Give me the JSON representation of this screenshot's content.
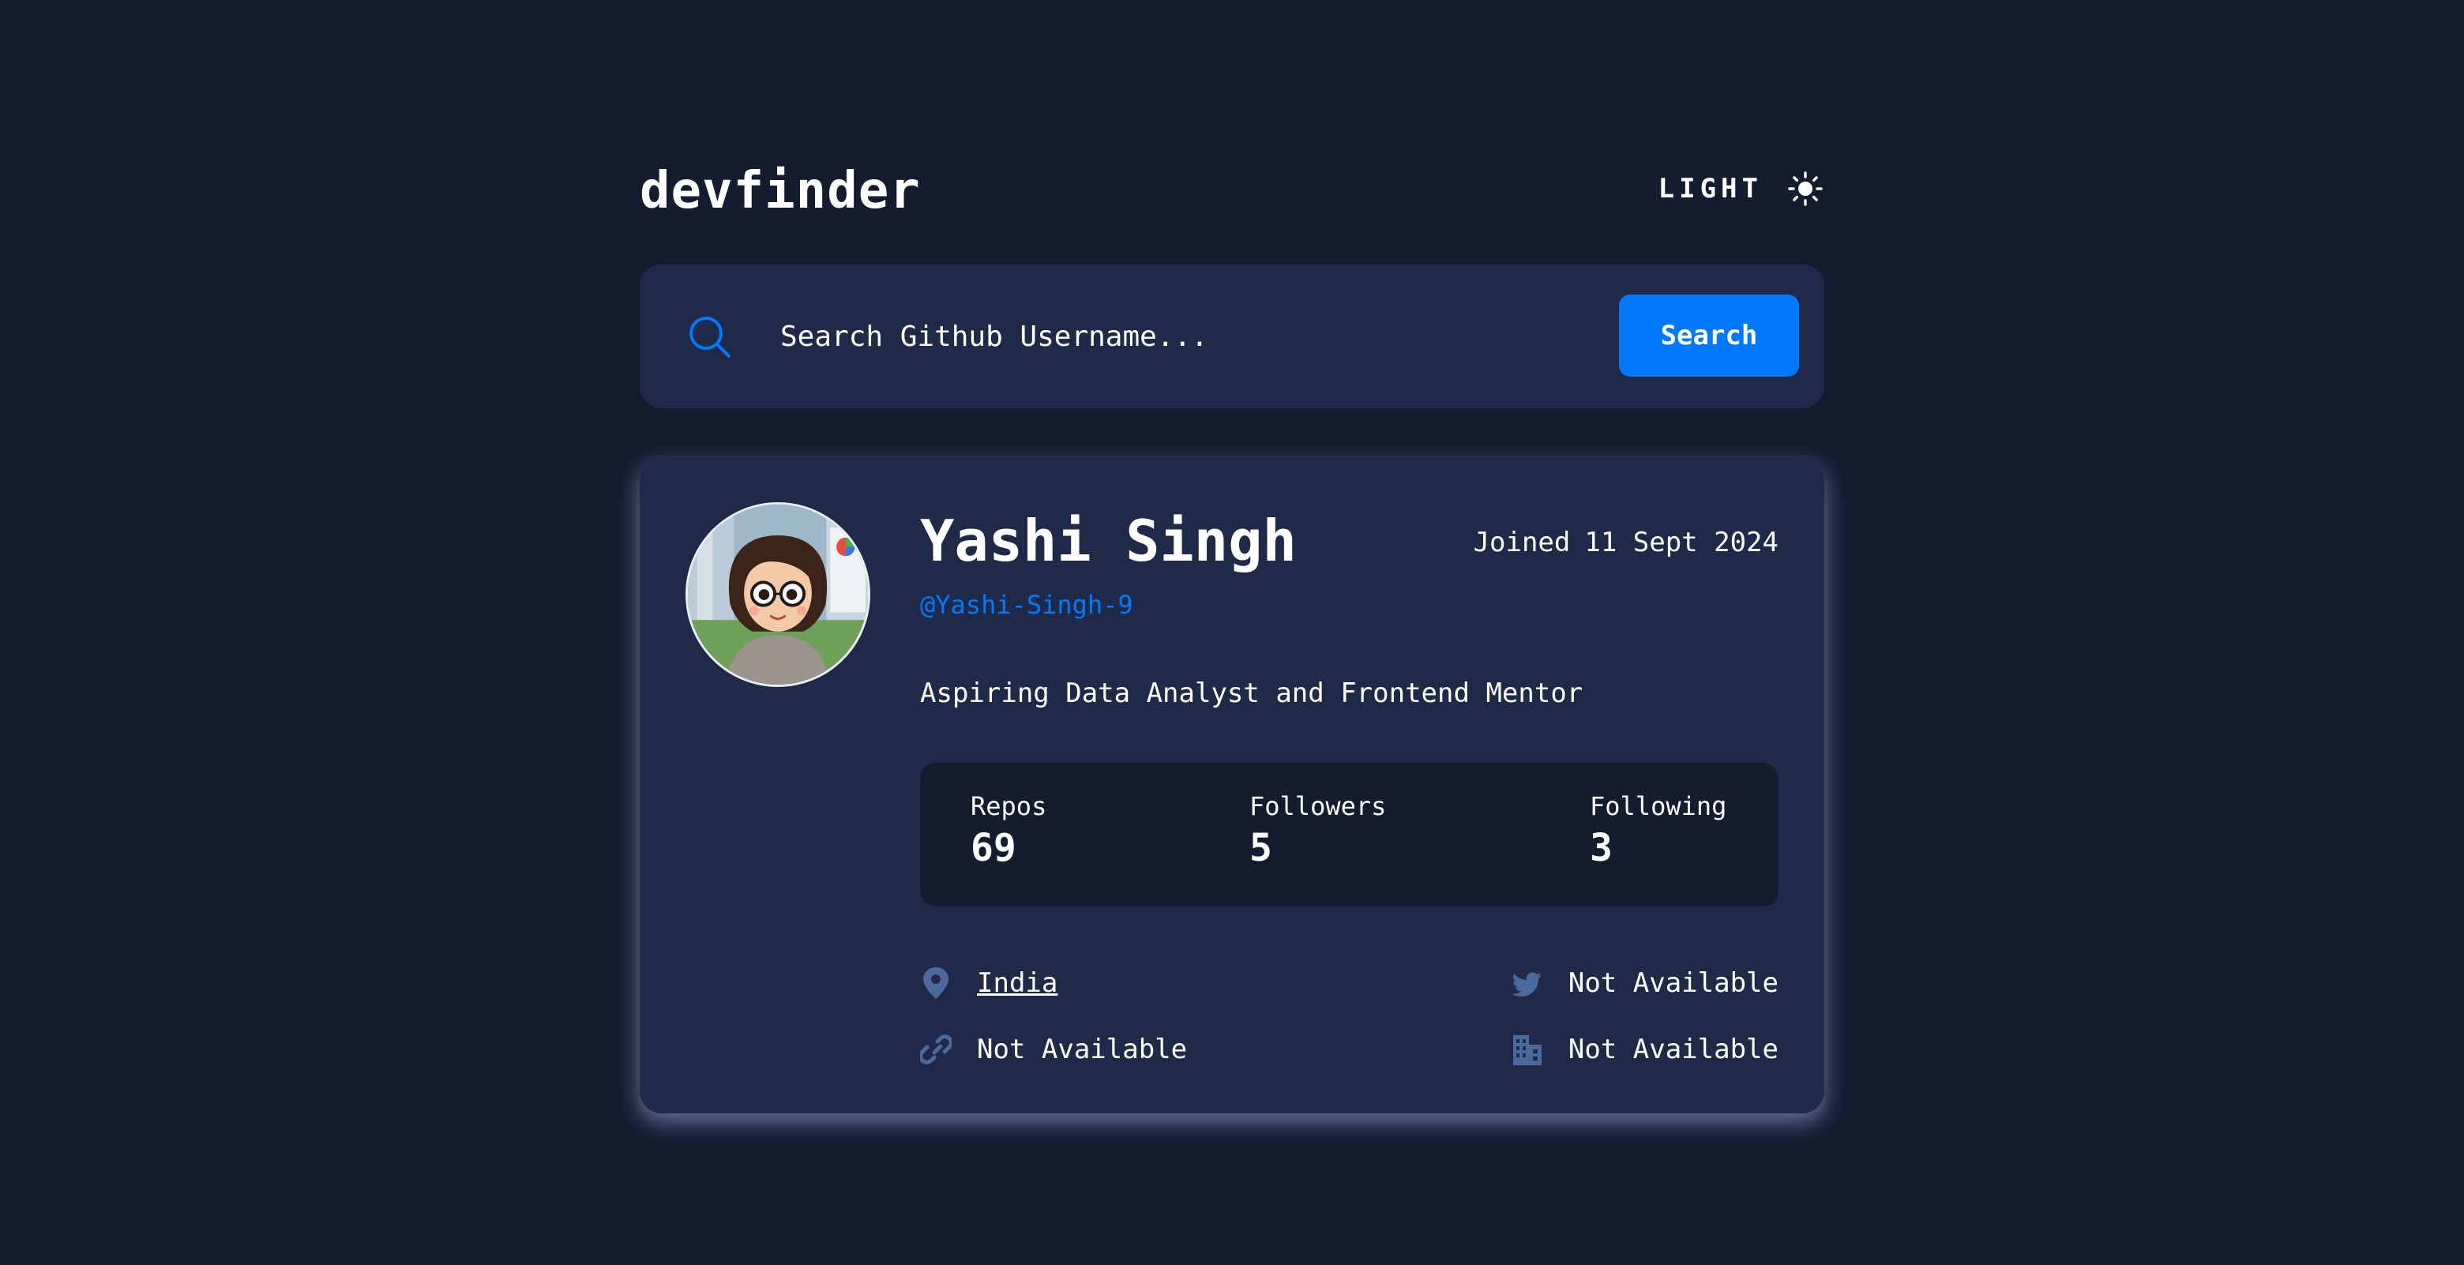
{
  "header": {
    "logo": "devfinder",
    "theme_label": "LIGHT",
    "theme_icon": "sun-icon"
  },
  "search": {
    "placeholder": "Search Github Username...",
    "value": "",
    "button_label": "Search",
    "icon": "search-icon"
  },
  "profile": {
    "name": "Yashi Singh",
    "login": "@Yashi-Singh-9",
    "joined_label": "Joined",
    "joined_date": "11 Sept 2024",
    "bio": "Aspiring Data Analyst and Frontend Mentor",
    "stats": {
      "repos_label": "Repos",
      "repos": "69",
      "followers_label": "Followers",
      "followers": "5",
      "following_label": "Following",
      "following": "3"
    },
    "links": {
      "location": "India",
      "twitter": "Not Available",
      "blog": "Not Available",
      "company": "Not Available"
    }
  },
  "colors": {
    "background": "#141c2f",
    "card": "#1f2a48",
    "accent": "#0079ff",
    "text": "#ffffff",
    "icon_muted": "#4b6a9b"
  }
}
